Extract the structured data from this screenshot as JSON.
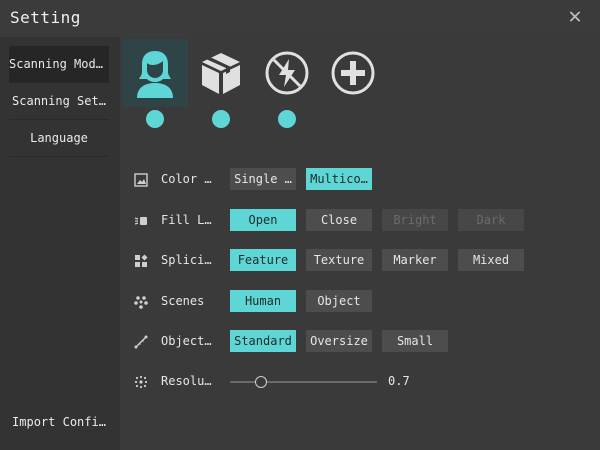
{
  "window": {
    "title": "Setting",
    "close_glyph": "✕"
  },
  "sidebar": {
    "items": [
      {
        "label": "Scanning Model"
      },
      {
        "label": "Scanning Set…"
      },
      {
        "label": "Language"
      }
    ],
    "import_label": "Import Confi…"
  },
  "modes": [
    {
      "icon": "person-icon",
      "selected": true
    },
    {
      "icon": "box-icon",
      "selected": false
    },
    {
      "icon": "no-flash-icon",
      "selected": false
    },
    {
      "icon": "add-circle-icon",
      "selected": false
    }
  ],
  "settings": {
    "color": {
      "label": "Color …",
      "options": [
        "Single …",
        "Multico…"
      ],
      "selected": "Multico…"
    },
    "fill": {
      "label": "Fill L…",
      "options": [
        "Open",
        "Close",
        "Bright",
        "Dark"
      ],
      "selected": "Open",
      "disabled": [
        "Bright",
        "Dark"
      ]
    },
    "splice": {
      "label": "Splici…",
      "options": [
        "Feature",
        "Texture",
        "Marker",
        "Mixed"
      ],
      "selected": "Feature"
    },
    "scenes": {
      "label": "Scenes",
      "options": [
        "Human",
        "Object"
      ],
      "selected": "Human"
    },
    "object": {
      "label": "Object…",
      "options": [
        "Standard",
        "Oversize",
        "Small"
      ],
      "selected": "Standard"
    },
    "resolution": {
      "label": "Resolu…",
      "value": "0.7"
    }
  },
  "colors": {
    "accent": "#5fd6d6",
    "background": "#3a3a3a",
    "sidebar": "#333333"
  }
}
